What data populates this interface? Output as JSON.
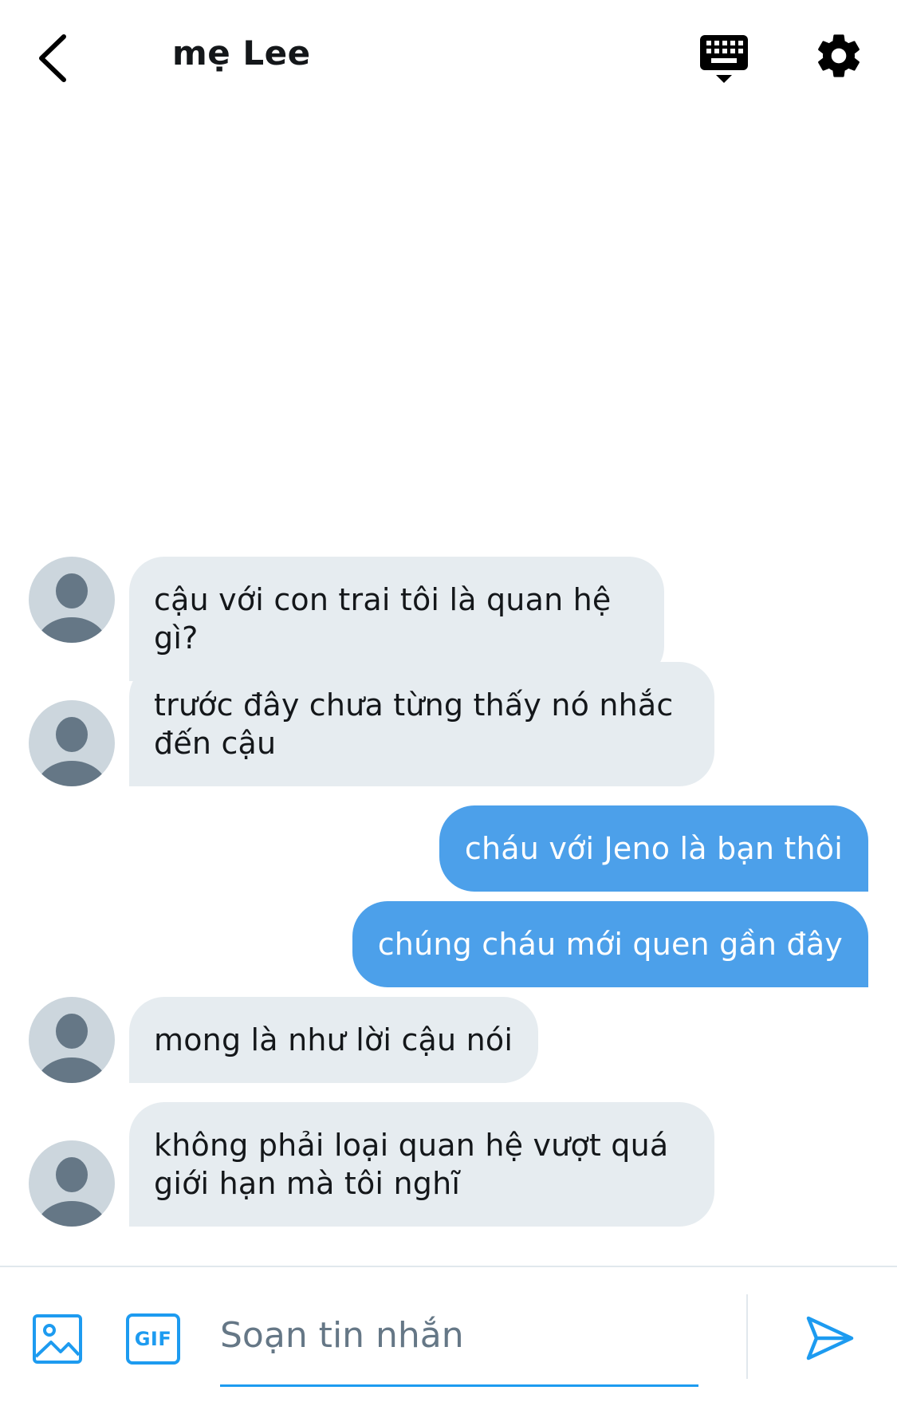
{
  "header": {
    "title": "mẹ Lee",
    "back_icon": "chevron-left-icon",
    "keyboard_icon": "keyboard-icon",
    "settings_icon": "gear-icon"
  },
  "messages": [
    {
      "direction": "in",
      "text": "cậu với con trai tôi là quan hệ gì?"
    },
    {
      "direction": "in",
      "text": "trước đây chưa từng thấy nó nhắc đến cậu"
    },
    {
      "direction": "out",
      "text": "cháu với Jeno là bạn thôi"
    },
    {
      "direction": "out",
      "text": "chúng cháu mới quen gần đây"
    },
    {
      "direction": "in",
      "text": "mong là như lời cậu nói"
    },
    {
      "direction": "in",
      "text": "không phải loại quan hệ vượt quá giới hạn mà tôi nghĩ"
    }
  ],
  "composer": {
    "media_icon": "image-icon",
    "gif_label": "GIF",
    "placeholder": "Soạn tin nhắn",
    "value": "",
    "send_icon": "send-icon"
  },
  "colors": {
    "accent": "#1d9bf0",
    "outgoing_bubble": "#4ca0ea",
    "incoming_bubble": "#e6ecf0",
    "avatar_bg": "#ccd6dd",
    "avatar_fg": "#657786"
  }
}
